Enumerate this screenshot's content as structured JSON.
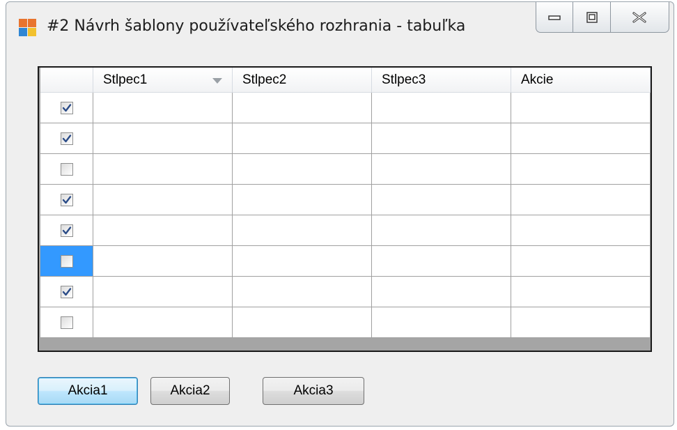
{
  "window": {
    "title": "#2 Návrh šablony používateľského rozhrania - tabuľka",
    "caption_buttons": [
      "minimize",
      "restore",
      "close"
    ]
  },
  "grid": {
    "columns": [
      "Stlpec1",
      "Stlpec2",
      "Stlpec3",
      "Akcie"
    ],
    "sorted_column": "Stlpec1",
    "rows": [
      {
        "checked": true,
        "selected": false,
        "cells": [
          "",
          "",
          "",
          ""
        ]
      },
      {
        "checked": true,
        "selected": false,
        "cells": [
          "",
          "",
          "",
          ""
        ]
      },
      {
        "checked": false,
        "selected": false,
        "cells": [
          "",
          "",
          "",
          ""
        ]
      },
      {
        "checked": true,
        "selected": false,
        "cells": [
          "",
          "",
          "",
          ""
        ]
      },
      {
        "checked": true,
        "selected": false,
        "cells": [
          "",
          "",
          "",
          ""
        ]
      },
      {
        "checked": false,
        "selected": true,
        "cells": [
          "",
          "",
          "",
          ""
        ]
      },
      {
        "checked": true,
        "selected": false,
        "cells": [
          "",
          "",
          "",
          ""
        ]
      },
      {
        "checked": false,
        "selected": false,
        "cells": [
          "",
          "",
          "",
          ""
        ]
      }
    ]
  },
  "buttons": {
    "action1": "Akcia1",
    "action2": "Akcia2",
    "action3": "Akcia3"
  },
  "colors": {
    "selection": "#3399ff",
    "check_mark": "#2a4b87"
  }
}
